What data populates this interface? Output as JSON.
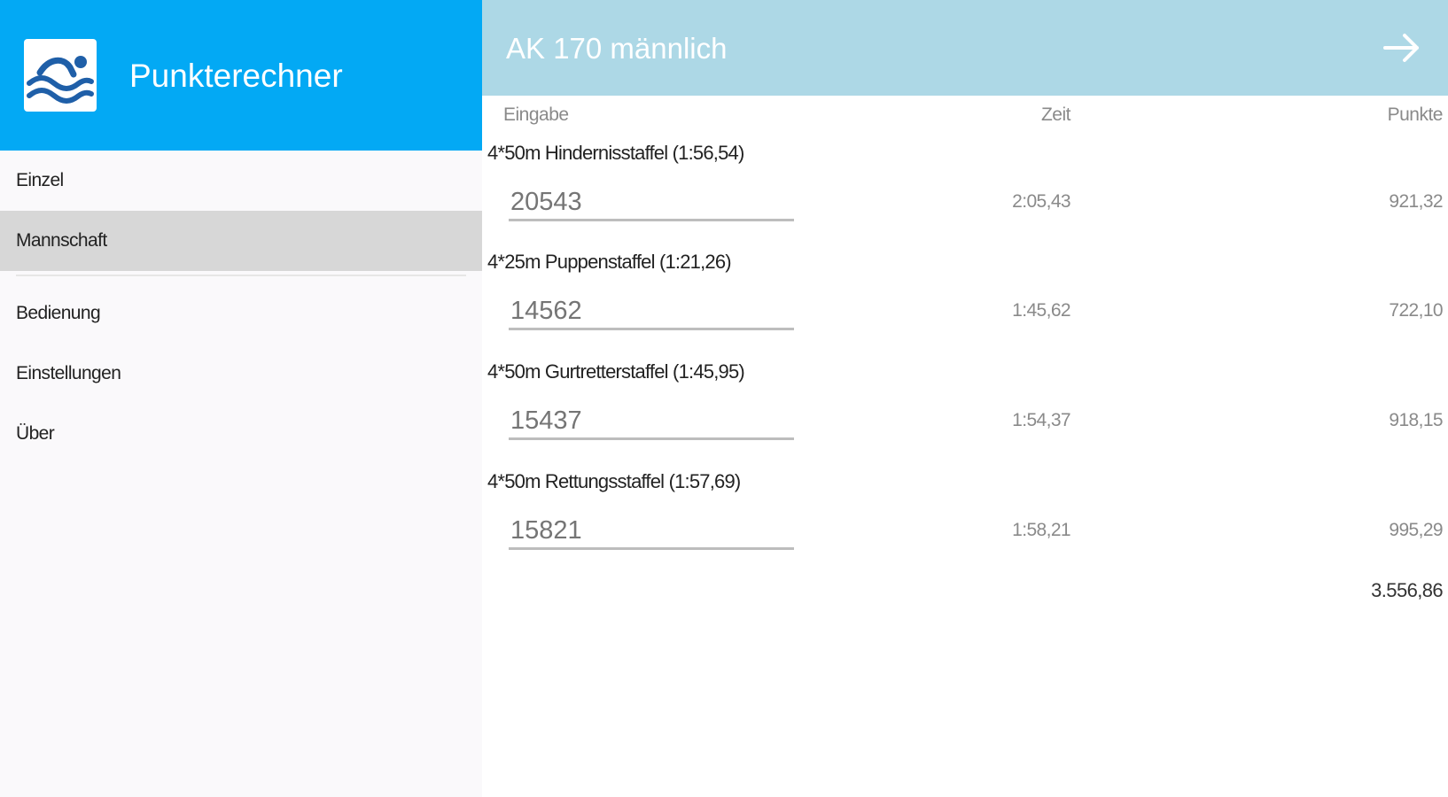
{
  "app": {
    "title": "Punkterechner",
    "logo_icon": "swimmer-icon",
    "header_color": "#03a9f4"
  },
  "nav": {
    "items": [
      {
        "label": "Einzel"
      },
      {
        "label": "Mannschaft",
        "active": true
      },
      {
        "label": "Bedienung"
      },
      {
        "label": "Einstellungen"
      },
      {
        "label": "Über"
      }
    ]
  },
  "topbar": {
    "title": "AK 170 männlich",
    "next_icon": "arrow-right-icon",
    "color": "#add8e6"
  },
  "table": {
    "headers": {
      "input": "Eingabe",
      "time": "Zeit",
      "points": "Punkte"
    },
    "rows": [
      {
        "event": "4*50m Hindernisstaffel (1:56,54)",
        "input": "20543",
        "time": "2:05,43",
        "points": "921,32"
      },
      {
        "event": "4*25m Puppenstaffel (1:21,26)",
        "input": "14562",
        "time": "1:45,62",
        "points": "722,10"
      },
      {
        "event": "4*50m Gurtretterstaffel (1:45,95)",
        "input": "15437",
        "time": "1:54,37",
        "points": "918,15"
      },
      {
        "event": "4*50m Rettungsstaffel (1:57,69)",
        "input": "15821",
        "time": "1:58,21",
        "points": "995,29"
      }
    ],
    "total": "3.556,86"
  }
}
